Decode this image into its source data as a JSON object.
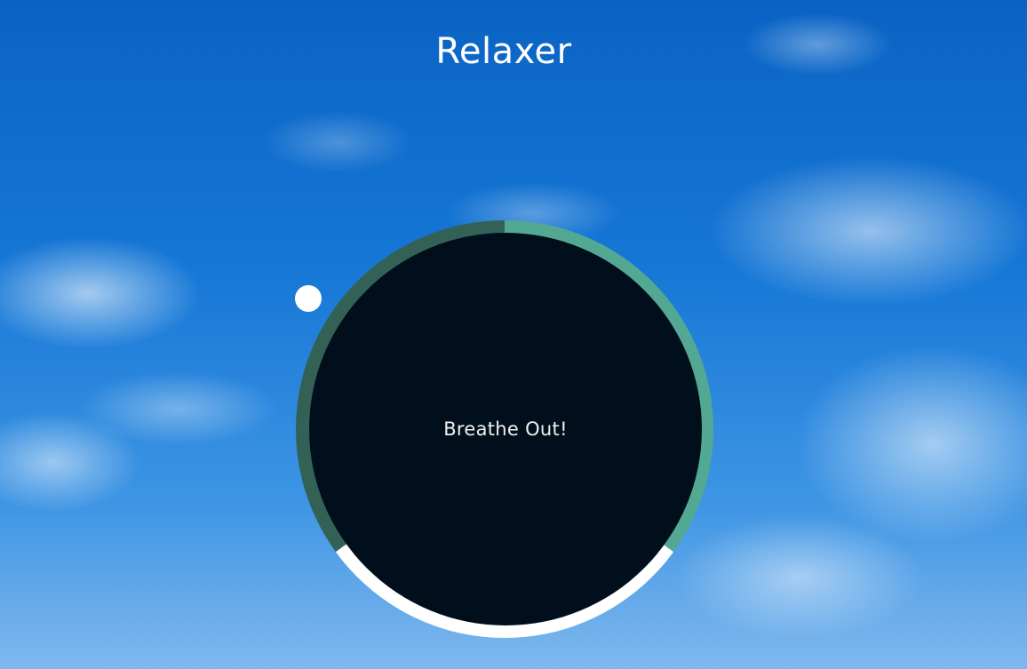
{
  "app": {
    "title": "Relaxer"
  },
  "breathing": {
    "instruction": "Breathe Out!"
  },
  "colors": {
    "phase_breathe_in": "#53a893",
    "phase_hold": "#ffffff",
    "phase_breathe_out": "#336156",
    "core": "#010f1c",
    "pointer": "#ffffff"
  },
  "icons": {
    "pointer": "progress-pointer-dot"
  }
}
